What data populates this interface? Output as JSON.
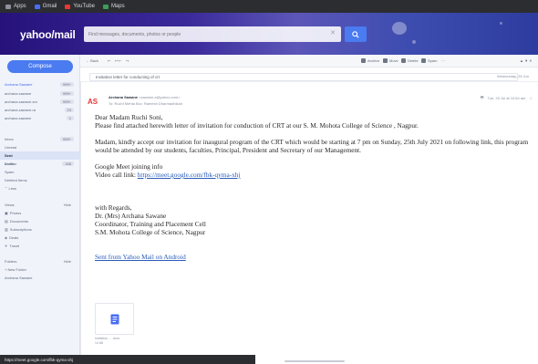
{
  "bookmarks": [
    {
      "label": "Apps",
      "icon": "apps-icon",
      "color": "#8d9199"
    },
    {
      "label": "Gmail",
      "icon": "mail-icon",
      "color": "#4a6cf7"
    },
    {
      "label": "YouTube",
      "icon": "youtube-icon",
      "color": "#e53935"
    },
    {
      "label": "Maps",
      "icon": "maps-icon",
      "color": "#3c9e5a"
    }
  ],
  "header": {
    "logo": "yahoo/mail",
    "search_placeholder": "Find messages, documents, photos or people",
    "search_clear": "✕",
    "search_icon": "search-icon"
  },
  "sidebar": {
    "compose": "Compose",
    "account": "Archana Sawane",
    "account_badge": "999+",
    "accounts": [
      {
        "label": "archana.sawane",
        "count": "999+"
      },
      {
        "label": "archana.sawane.sm",
        "count": "999+"
      },
      {
        "label": "archana.sawane.ra",
        "count": "23"
      },
      {
        "label": "archana.sawane",
        "count": "1"
      }
    ],
    "folders": [
      {
        "label": "Inbox",
        "count": "999+"
      },
      {
        "label": "Unread",
        "count": ""
      },
      {
        "label": "Starred",
        "count": ""
      },
      {
        "label": "Drafts",
        "count": "168"
      },
      {
        "label": "Sent",
        "count": ""
      },
      {
        "label": "Archive",
        "count": ""
      },
      {
        "label": "Spam",
        "count": ""
      },
      {
        "label": "Deleted Items",
        "count": ""
      },
      {
        "label": "⌃ Less",
        "count": ""
      }
    ],
    "views_header": "Views",
    "views_hide": "Hide",
    "views": [
      {
        "label": "Photos",
        "icon": "photos-icon"
      },
      {
        "label": "Documents",
        "icon": "documents-icon"
      },
      {
        "label": "Subscriptions",
        "icon": "subscriptions-icon"
      },
      {
        "label": "Deals",
        "icon": "deals-icon"
      },
      {
        "label": "Travel",
        "icon": "travel-icon"
      }
    ],
    "folders_header": "Folders",
    "folders_hide": "Hide",
    "new_folder": "+ New Folder",
    "subfolder": "Archana Sawane"
  },
  "toolbar": {
    "back": "← Back",
    "archive": "Archive",
    "move": "Move",
    "delete": "Delete",
    "spam": "Spam",
    "more": "⋯"
  },
  "message": {
    "subject": "Invitation letter for conducting of crt",
    "subject_date": "Wednesday, 25 Jun",
    "sender_initials": "AS",
    "sender_name": "Archana Sawane",
    "sender_email": "<sawane.a@yahoo.com>",
    "to": "To: Ruchi Mehta  Bcc: Ramesh Dharmadhikari",
    "date": "Tue, 20 Jul at 10:54 am",
    "body": {
      "greeting": "Dear Madam Ruchi Soni,",
      "line1": "Please find attached herewith letter of invitation for conduction of CRT at our S. M. Mohota College of Science , Nagpur.",
      "para2": "Madam, kindly accept our invitation for inaugural program of the CRT which would be starting at 7 pm on Sunday, 25th July 2021 on following link, this program would be attended by our students, faculties, Principal, President and Secretary of our Management.",
      "meet_title": "Google Meet joining info",
      "meet_label": "Video call link: ",
      "meet_link": "https://meet.google.com/fbk-qyma-xhj",
      "regards": "with Regards,",
      "sig1": "Dr. (Mrs) Archana Sawane",
      "sig2": "Coordinator, Training and Placement Cell",
      "sig3": "S.M. Mohota College of Science, Nagpur",
      "signature_link": "Sent from Yahoo Mail on Android"
    },
    "attachment_name": "Invitation ... .docx",
    "attachment_size": "14 kB"
  },
  "status_bar": "https://meet.google.com/fbk-qyma-xhj"
}
